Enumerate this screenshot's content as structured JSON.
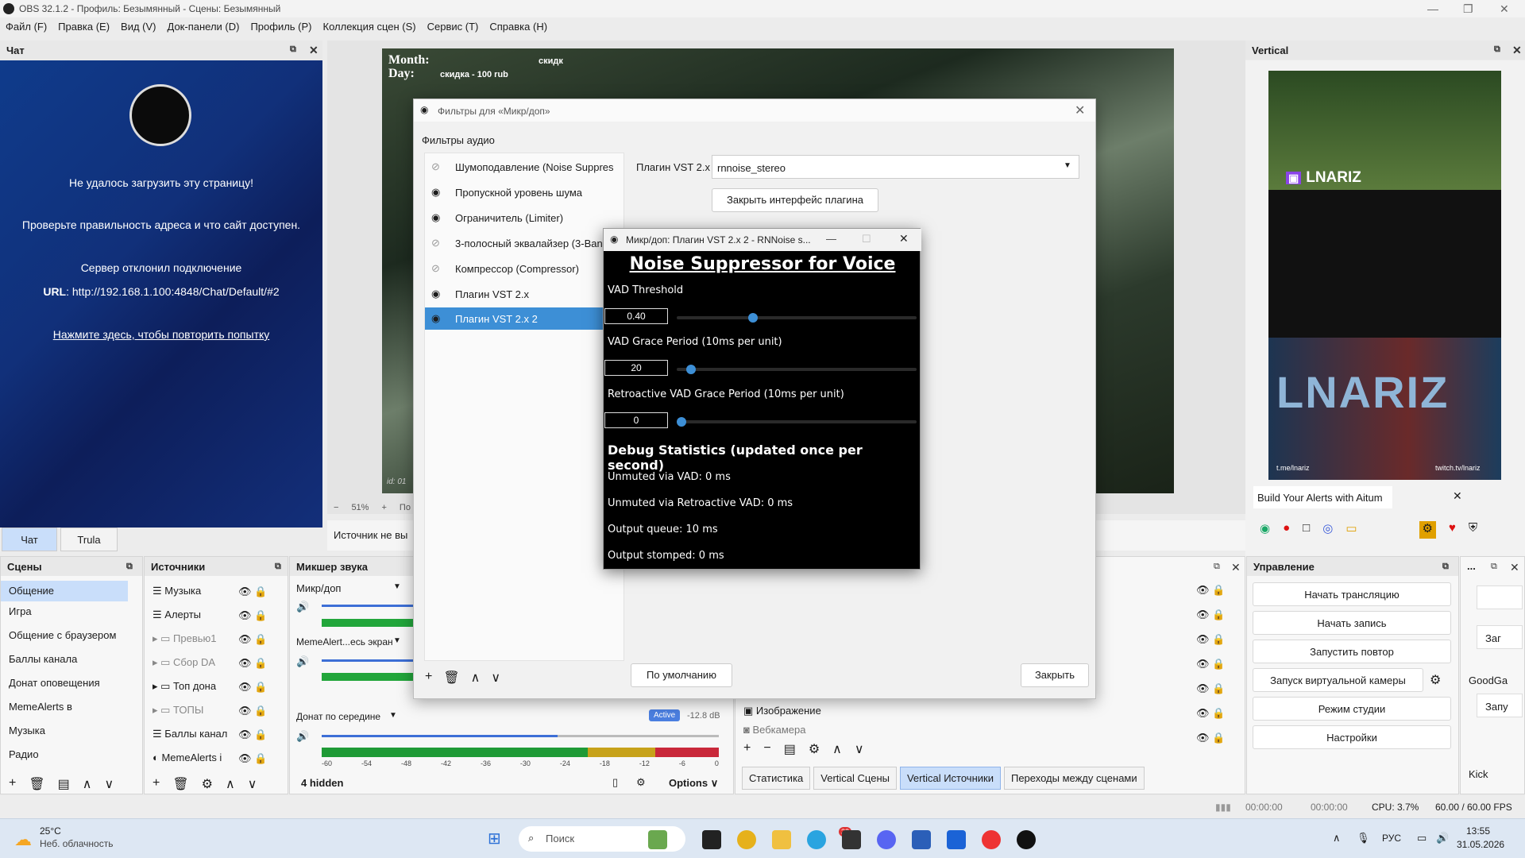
{
  "window": {
    "title": "OBS 32.1.2 - Профиль: Безымянный - Сцены: Безымянный"
  },
  "menu": [
    "Файл (F)",
    "Правка (E)",
    "Вид (V)",
    "Док-панели (D)",
    "Профиль (P)",
    "Коллекция сцен (S)",
    "Сервис (T)",
    "Справка (H)"
  ],
  "chat": {
    "title": "Чат",
    "error_title": "Не удалось загрузить эту страницу!",
    "error_hint": "Проверьте правильность адреса и что сайт доступен.",
    "error_reason": "Сервер отклонил подключение",
    "url_label": "URL",
    "url": "http://192.168.1.100:4848/Chat/Default/#2",
    "retry": "Нажмите здесь, чтобы повторить попытку",
    "tabs": [
      "Чат",
      "Trula"
    ]
  },
  "preview": {
    "overlay_month": "Month:",
    "overlay_day": "Day:",
    "overlay_discount": "скидка - 100 rub",
    "overlay_discount2": "скидк",
    "id_label": "id: 01",
    "zoom": "51%",
    "zoom_minus": "−",
    "zoom_plus": "+",
    "zoom_rest": "По"
  },
  "source_bar": {
    "label": "Источник не вы"
  },
  "vertical": {
    "title": "Vertical",
    "brand": "LNARIZ",
    "brand_big": "LNARIZ",
    "tme": "t.me/lnariz",
    "twitch": "twitch.tv/lnariz",
    "alert": "Build Your Alerts with Aitum",
    "alert_close": "✕"
  },
  "scenes": {
    "title": "Сцены",
    "items": [
      "Общение",
      "Игра",
      "Общение с браузером",
      "Баллы канала",
      "Донат оповещения",
      "MemeAlerts в",
      "Музыка",
      "Радио"
    ],
    "selected": 0
  },
  "sources": {
    "title": "Источники",
    "items": [
      "Музыка",
      "Алерты",
      "Превью1",
      "Сбор DA",
      "Топ дона",
      "ТОПЫ",
      "Баллы канал",
      "MemeAlerts i"
    ]
  },
  "mixer": {
    "title": "Микшер звука",
    "channels": [
      {
        "name": "Микр/доп"
      },
      {
        "name": "MemeAlert...есь экран"
      },
      {
        "name": "Донат по середине",
        "badge": "Active",
        "db": "-12.8 dB"
      }
    ],
    "ticks": [
      "-60",
      "-54",
      "-48",
      "-42",
      "-36",
      "-30",
      "-24",
      "-18",
      "-12",
      "-6",
      "0"
    ],
    "hidden": "4 hidden",
    "options": "Options"
  },
  "filters": {
    "title": "Фильтры для «Микр/доп»",
    "section": "Фильтры аудио",
    "items": [
      "Шумоподавление (Noise Suppres",
      "Пропускной уровень шума",
      "Ограничитель (Limiter)",
      "3-полосный эквалайзер (3-Ban",
      "Компрессор (Compressor)",
      "Плагин VST 2.x",
      "Плагин VST 2.x 2"
    ],
    "selected": 6,
    "plugin_label": "Плагин VST 2.x",
    "plugin_value": "rnnoise_stereo",
    "close_ui": "Закрыть интерфейс плагина",
    "defaults": "По умолчанию",
    "close": "Закрыть",
    "close_x": "✕"
  },
  "vst": {
    "title": "Микр/доп: Плагин VST 2.x 2 - RNNoise s...",
    "heading": "Noise Suppressor for Voice",
    "vad_label": "VAD Threshold",
    "vad_value": "0.40",
    "vad_level": 0.31,
    "grace_label": "VAD Grace Period (10ms per unit)",
    "grace_value": "20",
    "grace_level": 0.04,
    "retro_label": "Retroactive VAD Grace Period (10ms per unit)",
    "retro_value": "0",
    "retro_level": 0.0,
    "debug": "Debug Statistics (updated once per second)",
    "stats": [
      "Unmuted via VAD: 0 ms",
      "Unmuted via Retroactive VAD: 0 ms",
      "Output queue: 10 ms",
      "Output stomped: 0 ms"
    ]
  },
  "vsources": {
    "items": [
      "Изображение",
      "Вебкамера"
    ],
    "tabs": [
      "Статистика",
      "Vertical Сцены",
      "Vertical Источники",
      "Переходы между сценами"
    ],
    "active_tab": 2
  },
  "controls": {
    "title": "Управление",
    "buttons": [
      "Начать трансляцию",
      "Начать запись",
      "Запустить повтор",
      "Запуск виртуальной камеры",
      "Режим студии",
      "Настройки"
    ]
  },
  "extra": {
    "title": "...",
    "items": [
      "Заг",
      "GoodGa",
      "Запу",
      "Kick"
    ]
  },
  "status": {
    "time1": "00:00:00",
    "time2": "00:00:00",
    "cpu": "CPU: 3.7%",
    "fps": "60.00 / 60.00 FPS"
  },
  "taskbar": {
    "temp": "25°C",
    "weather": "Неб. облачность",
    "search": "Поиск",
    "lang": "РУС",
    "time": "13:55",
    "date": "31.05.2026",
    "badge": "33"
  },
  "colors": {
    "accent": "#3d8fd6",
    "selected": "#c9defa",
    "chat_bg": "#11307a"
  }
}
